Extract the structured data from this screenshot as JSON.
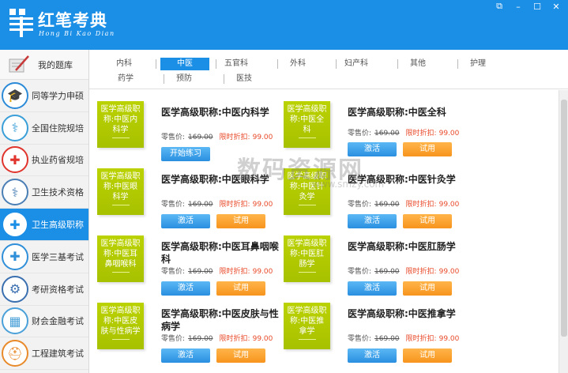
{
  "app": {
    "name": "红笔考典",
    "subtitle": "Hong Bi Kao Dian"
  },
  "window_controls": {
    "restore": "⧉",
    "minimize": "–",
    "maximize": "☐",
    "close": "✕"
  },
  "sidebar": {
    "header_label": "我的题库",
    "items": [
      {
        "label": "同等学力申硕",
        "icon": "graduation-cap-icon",
        "color": "#2b8ad8"
      },
      {
        "label": "全国住院规培",
        "icon": "stethoscope-icon",
        "color": "#3a9fd8"
      },
      {
        "label": "执业药省规培",
        "icon": "medical-cross-icon",
        "color": "#e0342c"
      },
      {
        "label": "卫生技术资格",
        "icon": "doctor-icon",
        "color": "#4a7fb5"
      },
      {
        "label": "卫生高级职称",
        "icon": "medical-kit-icon",
        "color": "#1b8ee6",
        "active": true
      },
      {
        "label": "医学三基考试",
        "icon": "first-aid-kit-icon",
        "color": "#2f8fd9"
      },
      {
        "label": "考研资格考试",
        "icon": "gear-icon",
        "color": "#3a6fb0"
      },
      {
        "label": "财会金融考试",
        "icon": "calculator-icon",
        "color": "#4aa0d8"
      },
      {
        "label": "工程建筑考试",
        "icon": "helmet-icon",
        "color": "#e88a2a"
      }
    ]
  },
  "tabs": {
    "row1": [
      "内科",
      "中医",
      "五官科",
      "外科",
      "妇产科",
      "其他",
      "护理"
    ],
    "row2": [
      "药学",
      "预防",
      "医技"
    ],
    "active": "中医"
  },
  "courses": [
    {
      "thumb": "医学高级职称:中医内科学",
      "title": "医学高级职称:中医内科学",
      "retail_label": "零售价:",
      "retail_price": "169.00",
      "discount_label": "限时折扣:",
      "discount_price": "99.00",
      "buttons": [
        "开始练习"
      ]
    },
    {
      "thumb": "医学高级职称:中医全科",
      "title": "医学高级职称:中医全科",
      "retail_label": "零售价:",
      "retail_price": "169.00",
      "discount_label": "限时折扣:",
      "discount_price": "99.00",
      "buttons": [
        "激活",
        "试用"
      ]
    },
    {
      "thumb": "医学高级职称:中医眼科学",
      "title": "医学高级职称:中医眼科学",
      "retail_label": "零售价:",
      "retail_price": "169.00",
      "discount_label": "限时折扣:",
      "discount_price": "99.00",
      "buttons": [
        "激活",
        "试用"
      ]
    },
    {
      "thumb": "医学高级职称:中医针灸学",
      "title": "医学高级职称:中医针灸学",
      "retail_label": "零售价:",
      "retail_price": "169.00",
      "discount_label": "限时折扣:",
      "discount_price": "99.00",
      "buttons": [
        "激活",
        "试用"
      ]
    },
    {
      "thumb": "医学高级职称:中医耳鼻咽喉科",
      "title": "医学高级职称:中医耳鼻咽喉科",
      "retail_label": "零售价:",
      "retail_price": "169.00",
      "discount_label": "限时折扣:",
      "discount_price": "99.00",
      "buttons": [
        "激活",
        "试用"
      ]
    },
    {
      "thumb": "医学高级职称:中医肛肠学",
      "title": "医学高级职称:中医肛肠学",
      "retail_label": "零售价:",
      "retail_price": "169.00",
      "discount_label": "限时折扣:",
      "discount_price": "99.00",
      "buttons": [
        "激活",
        "试用"
      ]
    },
    {
      "thumb": "医学高级职称:中医皮肤与性病学",
      "title": "医学高级职称:中医皮肤与性病学",
      "retail_label": "零售价:",
      "retail_price": "169.00",
      "discount_label": "限时折扣:",
      "discount_price": "99.00",
      "buttons": [
        "激活",
        "试用"
      ]
    },
    {
      "thumb": "医学高级职称:中医推拿学",
      "title": "医学高级职称:中医推拿学",
      "retail_label": "零售价:",
      "retail_price": "169.00",
      "discount_label": "限时折扣:",
      "discount_price": "99.00",
      "buttons": [
        "激活",
        "试用"
      ]
    }
  ],
  "watermark": {
    "main": "数码资源网",
    "sub": "www.smzy.com"
  },
  "colors": {
    "brand_blue": "#1b8ee6",
    "thumb_green": "#a7c100",
    "discount_red": "#e94a2a",
    "trial_orange": "#f7941d"
  }
}
